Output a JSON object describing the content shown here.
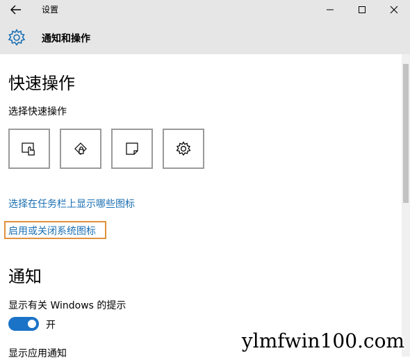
{
  "window": {
    "title": "设置",
    "controls": [
      "minimize-icon",
      "maximize-icon",
      "close-icon"
    ],
    "back_icon": "arrow-left-icon"
  },
  "header": {
    "icon": "gear-icon",
    "title": "通知和操作"
  },
  "quick_actions": {
    "heading": "快速操作",
    "subheading": "选择快速操作",
    "tiles": [
      {
        "icon": "tablet-mode-icon"
      },
      {
        "icon": "location-icon"
      },
      {
        "icon": "note-icon"
      },
      {
        "icon": "gear-icon"
      }
    ]
  },
  "links": {
    "taskbar_icons": "选择在任务栏上显示哪些图标",
    "system_icons": "启用或关闭系统图标"
  },
  "notifications": {
    "heading": "通知",
    "windows_tips_label": "显示有关 Windows 的提示",
    "windows_tips_state": "开",
    "app_notifications_label": "显示应用通知"
  },
  "watermark": "ylmfwin100.com",
  "colors": {
    "link": "#1a6fb3",
    "toggle_on": "#1a73c7",
    "highlight_border": "#e0913c",
    "titlebar_bg": "#e6e6e6"
  }
}
